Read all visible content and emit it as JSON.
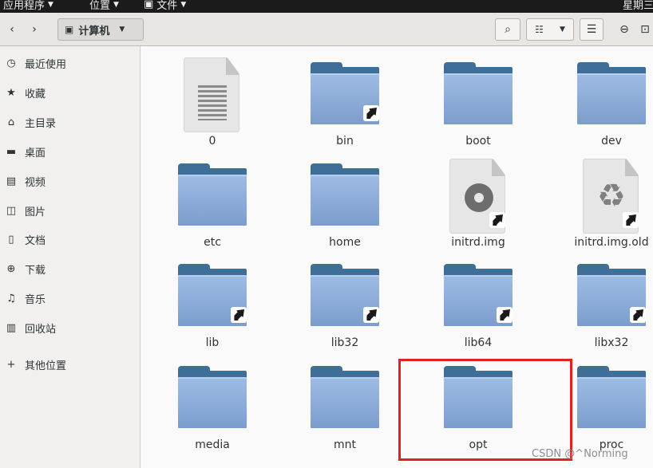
{
  "topbar": {
    "applications": "应用程序",
    "places": "位置",
    "files": "文件",
    "clock": "星期三"
  },
  "headerbar": {
    "back_icon": "chevron-left-icon",
    "forward_icon": "chevron-right-icon",
    "location": "计算机",
    "buttons": [
      "search-icon",
      "list-view-icon",
      "chevron-down-icon",
      "menu-icon",
      "minimize-icon",
      "maximize-icon"
    ]
  },
  "sidebar": {
    "items": [
      {
        "label": "最近使用",
        "icon": "recent-icon"
      },
      {
        "label": "收藏",
        "icon": "star-icon"
      },
      {
        "label": "主目录",
        "icon": "home-icon"
      },
      {
        "label": "桌面",
        "icon": "desktop-icon"
      },
      {
        "label": "视频",
        "icon": "video-icon"
      },
      {
        "label": "图片",
        "icon": "pictures-icon"
      },
      {
        "label": "文档",
        "icon": "documents-icon"
      },
      {
        "label": "下载",
        "icon": "downloads-icon"
      },
      {
        "label": "音乐",
        "icon": "music-icon"
      },
      {
        "label": "回收站",
        "icon": "trash-icon"
      },
      {
        "label": "其他位置",
        "icon": "plus-icon"
      }
    ]
  },
  "files": [
    {
      "name": "0",
      "type": "document"
    },
    {
      "name": "bin",
      "type": "folder-link"
    },
    {
      "name": "boot",
      "type": "folder"
    },
    {
      "name": "dev",
      "type": "folder"
    },
    {
      "name": "etc",
      "type": "folder"
    },
    {
      "name": "home",
      "type": "folder"
    },
    {
      "name": "initrd.img",
      "type": "disc-image-link"
    },
    {
      "name": "initrd.img.old",
      "type": "archive-link"
    },
    {
      "name": "lib",
      "type": "folder-link"
    },
    {
      "name": "lib32",
      "type": "folder-link"
    },
    {
      "name": "lib64",
      "type": "folder-link"
    },
    {
      "name": "libx32",
      "type": "folder-link"
    },
    {
      "name": "media",
      "type": "folder"
    },
    {
      "name": "mnt",
      "type": "folder"
    },
    {
      "name": "opt",
      "type": "folder"
    },
    {
      "name": "proc",
      "type": "folder"
    }
  ],
  "watermark": "CSDN @^Norming",
  "colors": {
    "highlight": "#e32020",
    "folder": "#7c9dcc",
    "folder_tab": "#3f6e98"
  }
}
